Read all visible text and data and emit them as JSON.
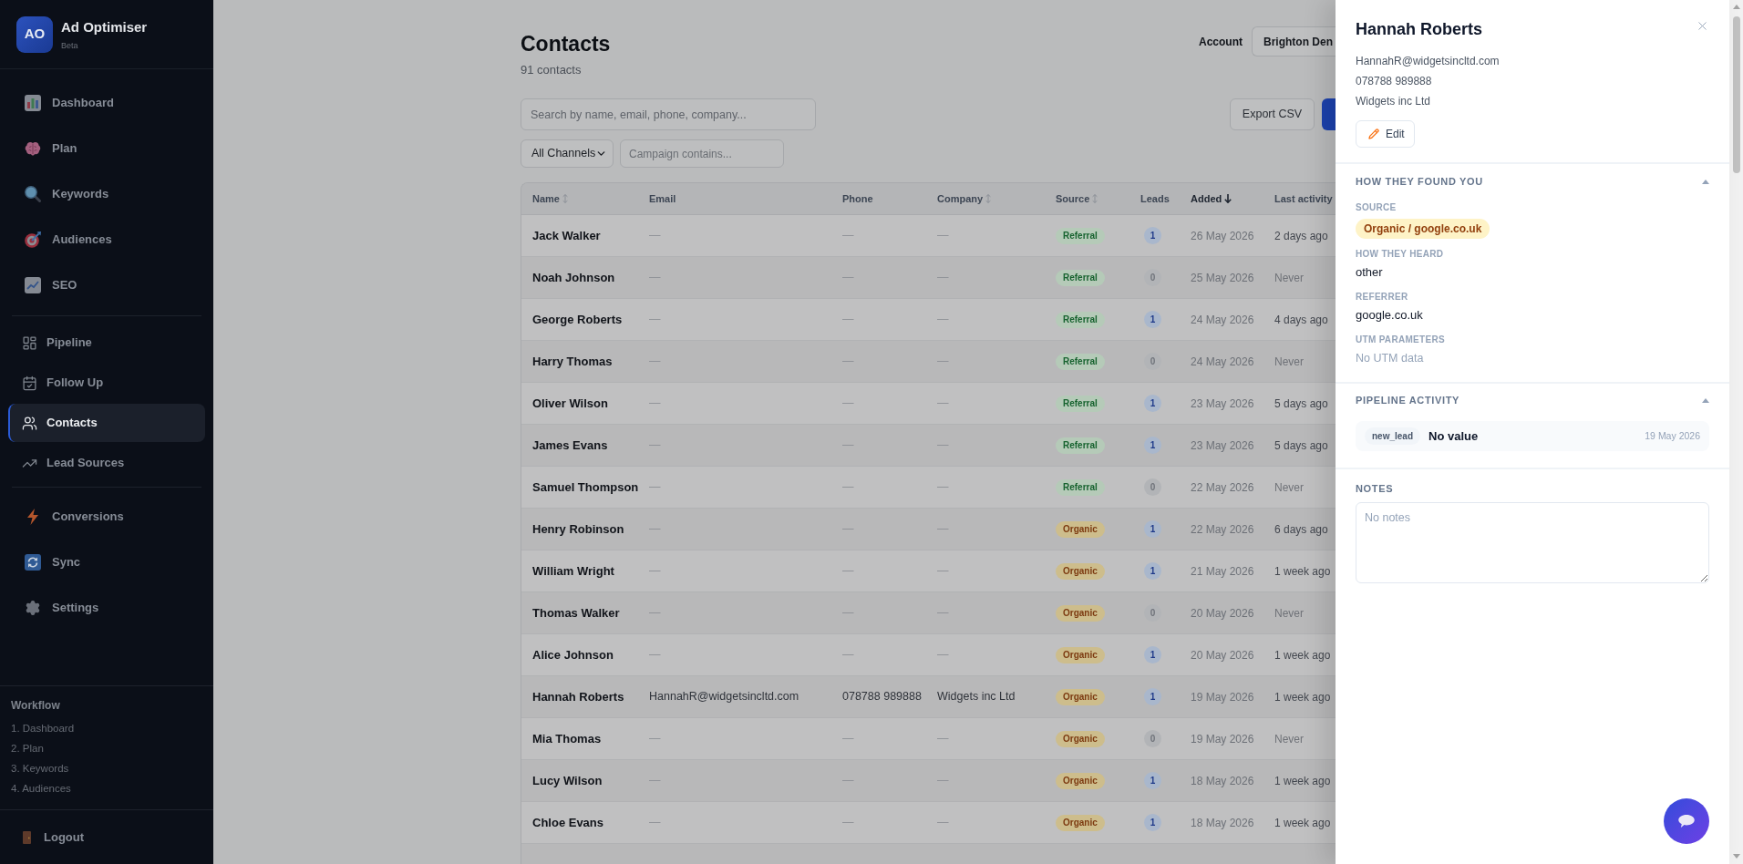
{
  "sidebar": {
    "brand": {
      "initials": "AO",
      "name": "Ad Optimiser",
      "tag": "Beta"
    },
    "nav_groups": [
      {
        "kind": "emoji",
        "items": [
          {
            "label": "Dashboard",
            "selected": false
          },
          {
            "label": "Plan",
            "selected": false
          },
          {
            "label": "Keywords",
            "selected": false
          },
          {
            "label": "Audiences",
            "selected": false
          },
          {
            "label": "SEO",
            "selected": false
          }
        ]
      },
      {
        "kind": "line",
        "items": [
          {
            "label": "Pipeline",
            "selected": false
          },
          {
            "label": "Follow Up",
            "selected": false
          },
          {
            "label": "Contacts",
            "selected": true
          },
          {
            "label": "Lead Sources",
            "selected": false
          }
        ]
      },
      {
        "kind": "emoji",
        "items": [
          {
            "label": "Conversions",
            "selected": false
          },
          {
            "label": "Sync",
            "selected": false
          },
          {
            "label": "Settings",
            "selected": false
          }
        ]
      }
    ],
    "workflow": {
      "title": "Workflow",
      "steps": [
        "1. Dashboard",
        "2. Plan",
        "3. Keywords",
        "4. Audiences"
      ]
    },
    "logout": "Logout"
  },
  "page": {
    "title": "Contacts",
    "subtitle": "91 contacts",
    "account": {
      "label": "Account",
      "value": "Brighton Den"
    },
    "search": {
      "placeholder": "Search by name, email, phone, company..."
    },
    "export_button": "Export CSV",
    "channel_filter": {
      "value": "All Channels"
    },
    "campaign_filter": {
      "placeholder": "Campaign contains..."
    }
  },
  "table": {
    "columns": [
      {
        "label": "Name",
        "sortable": true,
        "sorted": false
      },
      {
        "label": "Email",
        "sortable": false
      },
      {
        "label": "Phone",
        "sortable": false
      },
      {
        "label": "Company",
        "sortable": true,
        "sorted": false
      },
      {
        "label": "Source",
        "sortable": true,
        "sorted": false
      },
      {
        "label": "Leads",
        "sortable": false
      },
      {
        "label": "Added",
        "sortable": true,
        "sorted": true
      },
      {
        "label": "Last activity",
        "sortable": false
      }
    ],
    "rows": [
      {
        "name": "Jack Walker",
        "email": "—",
        "phone": "—",
        "company": "—",
        "has_details": false,
        "source": {
          "label": "Referral",
          "kind": "referral"
        },
        "leads": {
          "count": "1",
          "active": true
        },
        "added": "26 May 2026",
        "last_activity": {
          "text": "2 days ago",
          "muted": false
        }
      },
      {
        "name": "Noah Johnson",
        "email": "—",
        "phone": "—",
        "company": "—",
        "has_details": false,
        "source": {
          "label": "Referral",
          "kind": "referral"
        },
        "leads": {
          "count": "0",
          "active": false
        },
        "added": "25 May 2026",
        "last_activity": {
          "text": "Never",
          "muted": true
        }
      },
      {
        "name": "George Roberts",
        "email": "—",
        "phone": "—",
        "company": "—",
        "has_details": false,
        "source": {
          "label": "Referral",
          "kind": "referral"
        },
        "leads": {
          "count": "1",
          "active": true
        },
        "added": "24 May 2026",
        "last_activity": {
          "text": "4 days ago",
          "muted": false
        }
      },
      {
        "name": "Harry Thomas",
        "email": "—",
        "phone": "—",
        "company": "—",
        "has_details": false,
        "source": {
          "label": "Referral",
          "kind": "referral"
        },
        "leads": {
          "count": "0",
          "active": false
        },
        "added": "24 May 2026",
        "last_activity": {
          "text": "Never",
          "muted": true
        }
      },
      {
        "name": "Oliver Wilson",
        "email": "—",
        "phone": "—",
        "company": "—",
        "has_details": false,
        "source": {
          "label": "Referral",
          "kind": "referral"
        },
        "leads": {
          "count": "1",
          "active": true
        },
        "added": "23 May 2026",
        "last_activity": {
          "text": "5 days ago",
          "muted": false
        }
      },
      {
        "name": "James Evans",
        "email": "—",
        "phone": "—",
        "company": "—",
        "has_details": false,
        "source": {
          "label": "Referral",
          "kind": "referral"
        },
        "leads": {
          "count": "1",
          "active": true
        },
        "added": "23 May 2026",
        "last_activity": {
          "text": "5 days ago",
          "muted": false
        }
      },
      {
        "name": "Samuel Thompson",
        "email": "—",
        "phone": "—",
        "company": "—",
        "has_details": false,
        "source": {
          "label": "Referral",
          "kind": "referral"
        },
        "leads": {
          "count": "0",
          "active": false
        },
        "added": "22 May 2026",
        "last_activity": {
          "text": "Never",
          "muted": true
        }
      },
      {
        "name": "Henry Robinson",
        "email": "—",
        "phone": "—",
        "company": "—",
        "has_details": false,
        "source": {
          "label": "Organic",
          "kind": "organic"
        },
        "leads": {
          "count": "1",
          "active": true
        },
        "added": "22 May 2026",
        "last_activity": {
          "text": "6 days ago",
          "muted": false
        }
      },
      {
        "name": "William Wright",
        "email": "—",
        "phone": "—",
        "company": "—",
        "has_details": false,
        "source": {
          "label": "Organic",
          "kind": "organic"
        },
        "leads": {
          "count": "1",
          "active": true
        },
        "added": "21 May 2026",
        "last_activity": {
          "text": "1 week ago",
          "muted": false
        }
      },
      {
        "name": "Thomas Walker",
        "email": "—",
        "phone": "—",
        "company": "—",
        "has_details": false,
        "source": {
          "label": "Organic",
          "kind": "organic"
        },
        "leads": {
          "count": "0",
          "active": false
        },
        "added": "20 May 2026",
        "last_activity": {
          "text": "Never",
          "muted": true
        }
      },
      {
        "name": "Alice Johnson",
        "email": "—",
        "phone": "—",
        "company": "—",
        "has_details": false,
        "source": {
          "label": "Organic",
          "kind": "organic"
        },
        "leads": {
          "count": "1",
          "active": true
        },
        "added": "20 May 2026",
        "last_activity": {
          "text": "1 week ago",
          "muted": false
        }
      },
      {
        "name": "Hannah Roberts",
        "email": "HannahR@widgetsincltd.com",
        "phone": "078788 989888",
        "company": "Widgets inc Ltd",
        "has_details": true,
        "source": {
          "label": "Organic",
          "kind": "organic"
        },
        "leads": {
          "count": "1",
          "active": true
        },
        "added": "19 May 2026",
        "last_activity": {
          "text": "1 week ago",
          "muted": false
        }
      },
      {
        "name": "Mia Thomas",
        "email": "—",
        "phone": "—",
        "company": "—",
        "has_details": false,
        "source": {
          "label": "Organic",
          "kind": "organic"
        },
        "leads": {
          "count": "0",
          "active": false
        },
        "added": "19 May 2026",
        "last_activity": {
          "text": "Never",
          "muted": true
        }
      },
      {
        "name": "Lucy Wilson",
        "email": "—",
        "phone": "—",
        "company": "—",
        "has_details": false,
        "source": {
          "label": "Organic",
          "kind": "organic"
        },
        "leads": {
          "count": "1",
          "active": true
        },
        "added": "18 May 2026",
        "last_activity": {
          "text": "1 week ago",
          "muted": false
        }
      },
      {
        "name": "Chloe Evans",
        "email": "—",
        "phone": "—",
        "company": "—",
        "has_details": false,
        "source": {
          "label": "Organic",
          "kind": "organic"
        },
        "leads": {
          "count": "1",
          "active": true
        },
        "added": "18 May 2026",
        "last_activity": {
          "text": "1 week ago",
          "muted": false
        }
      }
    ]
  },
  "drawer": {
    "title": "Hannah Roberts",
    "contact_lines": [
      "HannahR@widgetsincltd.com",
      "078788 989888",
      "Widgets inc Ltd"
    ],
    "edit_button": "Edit",
    "sections": [
      {
        "kind": "details",
        "title": "HOW THEY FOUND YOU",
        "expanded": true,
        "fields": [
          {
            "label": "SOURCE",
            "kind": "badge",
            "value": "Organic / google.co.uk"
          },
          {
            "label": "HOW THEY HEARD",
            "kind": "text",
            "value": "other"
          },
          {
            "label": "REFERRER",
            "kind": "text",
            "value": "google.co.uk"
          },
          {
            "label": "UTM PARAMETERS",
            "kind": "empty",
            "value": "No UTM data"
          }
        ]
      },
      {
        "kind": "activity",
        "title": "PIPELINE ACTIVITY",
        "expanded": true,
        "entries": [
          {
            "stage": "new_lead",
            "value": "No value",
            "date": "19 May 2026"
          }
        ]
      },
      {
        "kind": "notes",
        "title": "NOTES",
        "notes": {
          "placeholder": "No notes"
        }
      }
    ]
  }
}
